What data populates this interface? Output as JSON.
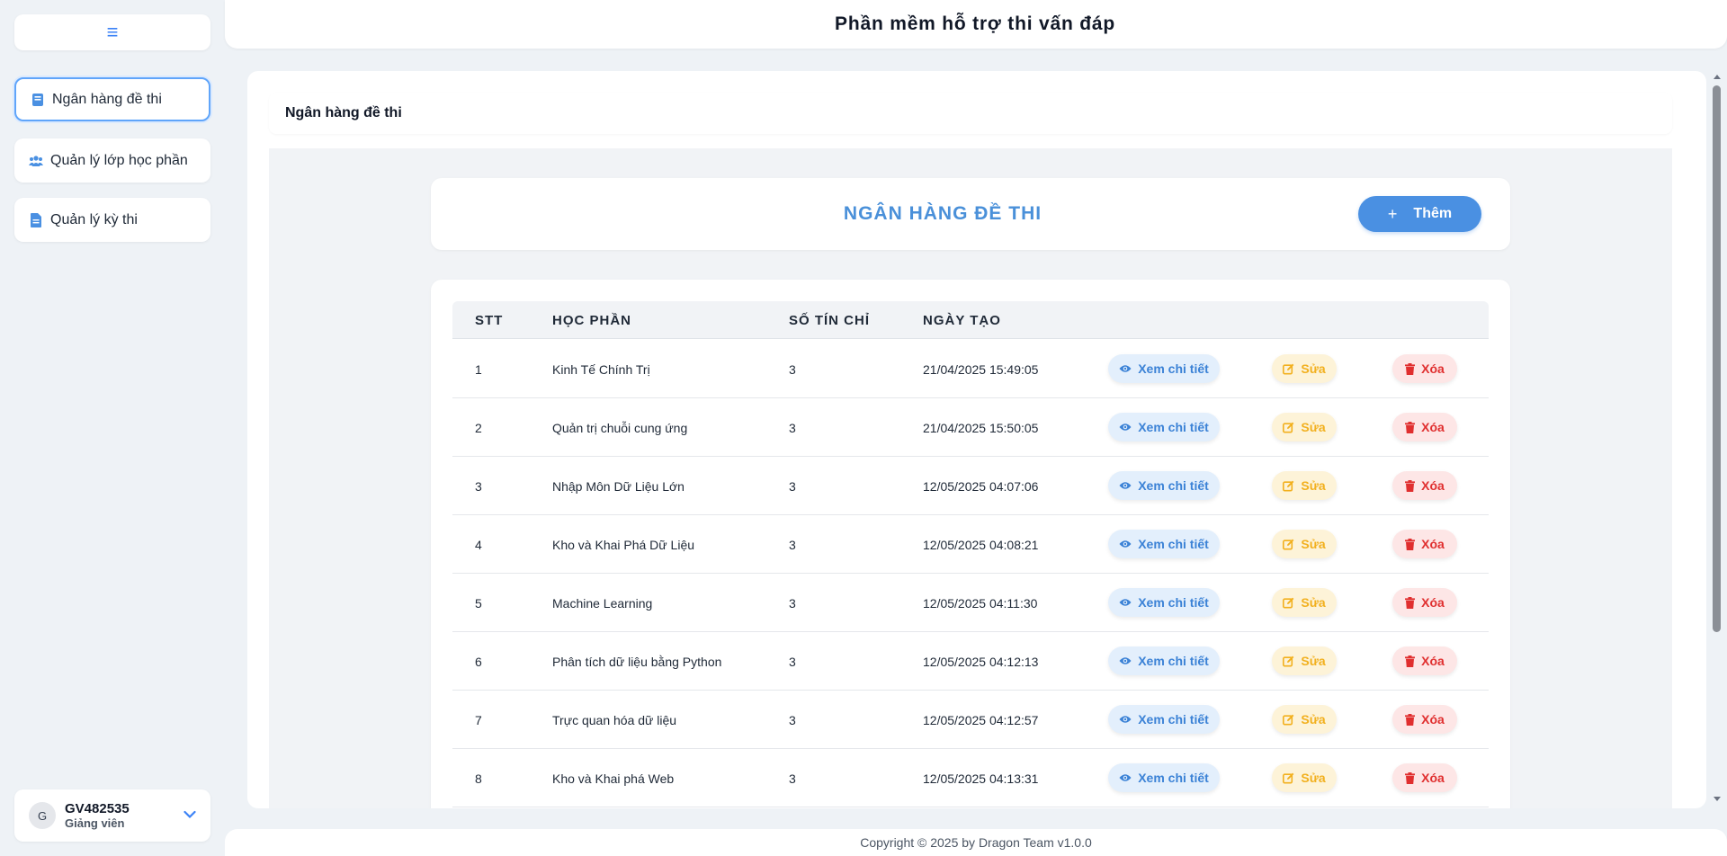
{
  "header": {
    "title": "Phần mềm hỗ trợ thi vấn đáp"
  },
  "sidebar": {
    "menu_icon": "hamburger-icon",
    "items": [
      {
        "label": "Ngân hàng đề thi",
        "icon": "book-icon",
        "active": true
      },
      {
        "label": "Quản lý lớp học phần",
        "icon": "users-icon",
        "active": false
      },
      {
        "label": "Quản lý kỳ thi",
        "icon": "file-icon",
        "active": false
      }
    ],
    "user": {
      "avatar": "G",
      "id": "GV482535",
      "role": "Giảng viên"
    }
  },
  "breadcrumb": "Ngân hàng đề thi",
  "page": {
    "title": "NGÂN HÀNG ĐỀ THI",
    "add_label": "Thêm"
  },
  "table": {
    "headers": {
      "stt": "STT",
      "course": "HỌC PHẦN",
      "credits": "SỐ TÍN CHỈ",
      "created": "NGÀY TẠO"
    },
    "actions": {
      "view": "Xem chi tiết",
      "edit": "Sửa",
      "delete": "Xóa"
    },
    "rows": [
      {
        "stt": "1",
        "course": "Kinh Tế Chính Trị",
        "credits": "3",
        "created": "21/04/2025 15:49:05"
      },
      {
        "stt": "2",
        "course": "Quản trị chuỗi cung ứng",
        "credits": "3",
        "created": "21/04/2025 15:50:05"
      },
      {
        "stt": "3",
        "course": "Nhập Môn Dữ Liệu Lớn",
        "credits": "3",
        "created": "12/05/2025 04:07:06"
      },
      {
        "stt": "4",
        "course": "Kho và Khai Phá Dữ Liệu",
        "credits": "3",
        "created": "12/05/2025 04:08:21"
      },
      {
        "stt": "5",
        "course": "Machine Learning",
        "credits": "3",
        "created": "12/05/2025 04:11:30"
      },
      {
        "stt": "6",
        "course": "Phân tích dữ liệu bằng Python",
        "credits": "3",
        "created": "12/05/2025 04:12:13"
      },
      {
        "stt": "7",
        "course": "Trực quan hóa dữ liệu",
        "credits": "3",
        "created": "12/05/2025 04:12:57"
      },
      {
        "stt": "8",
        "course": "Kho và Khai phá Web",
        "credits": "3",
        "created": "12/05/2025 04:13:31"
      }
    ]
  },
  "footer": "Copyright © 2025 by Dragon Team v1.0.0",
  "colors": {
    "accent": "#4a90e2",
    "edit": "#f2b01e",
    "delete": "#e02f2f"
  }
}
